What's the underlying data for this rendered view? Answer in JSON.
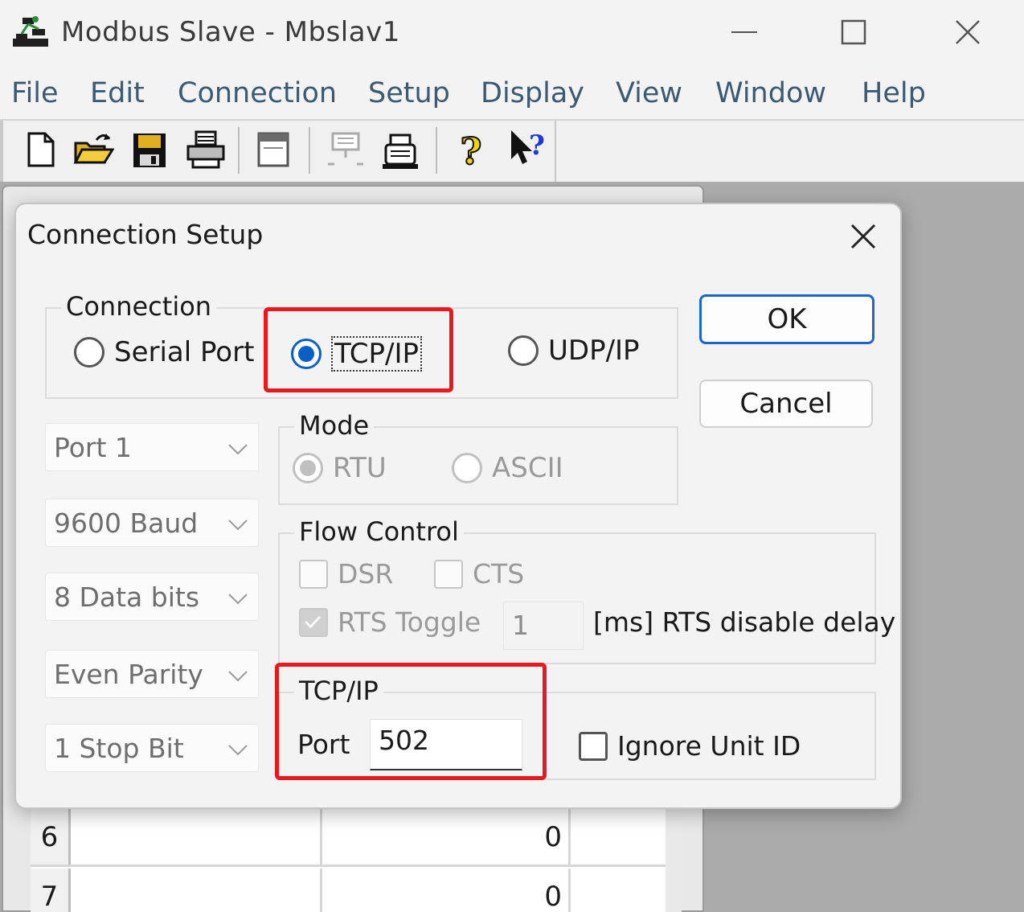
{
  "window": {
    "title": "Modbus Slave - Mbslav1",
    "icon": "modbus-network-icon",
    "controls": [
      "minimize-icon",
      "maximize-icon",
      "close-icon"
    ]
  },
  "menu": [
    "File",
    "Edit",
    "Connection",
    "Setup",
    "Display",
    "View",
    "Window",
    "Help"
  ],
  "toolbar": {
    "icons": [
      "new-document-icon",
      "open-folder-icon",
      "save-icon",
      "print-icon",
      "window-icon",
      "connect-icon",
      "disconnect-icon",
      "help-icon",
      "context-help-icon"
    ]
  },
  "grid": {
    "rows": [
      {
        "index": "6",
        "value": "0"
      },
      {
        "index": "7",
        "value": "0"
      }
    ]
  },
  "dialog": {
    "title": "Connection Setup",
    "connection": {
      "label": "Connection",
      "options": [
        "Serial Port",
        "TCP/IP",
        "UDP/IP"
      ],
      "selected": "TCP/IP"
    },
    "buttons": {
      "ok": "OK",
      "cancel": "Cancel"
    },
    "serial": {
      "port": "Port 1",
      "baud": "9600 Baud",
      "data_bits": "8 Data bits",
      "parity": "Even Parity",
      "stop_bits": "1 Stop Bit"
    },
    "mode": {
      "label": "Mode",
      "options": [
        "RTU",
        "ASCII"
      ],
      "selected": "RTU"
    },
    "flow_control": {
      "label": "Flow Control",
      "dsr": "DSR",
      "cts": "CTS",
      "rts_toggle": "RTS Toggle",
      "rts_delay_value": "1",
      "rts_delay_label": "[ms] RTS disable delay"
    },
    "tcpip": {
      "label": "TCP/IP",
      "port_label": "Port",
      "port_value": "502",
      "ignore_unit_id": "Ignore Unit ID"
    },
    "highlight_color": "#e8181f",
    "accent_color": "#0a5fc4"
  }
}
